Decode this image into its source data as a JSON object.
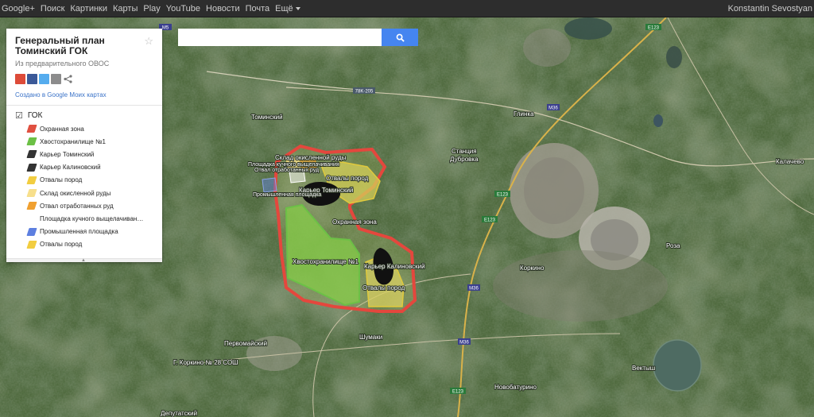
{
  "topbar": {
    "links": [
      "Google+",
      "Поиск",
      "Картинки",
      "Карты",
      "Play",
      "YouTube",
      "Новости",
      "Почта",
      "Ещё"
    ],
    "user": "Konstantin Sevostyan"
  },
  "search": {
    "placeholder": "",
    "button_icon": "search-icon"
  },
  "panel": {
    "title": "Генеральный план Томинский ГОК",
    "subtitle": "Из предварительного ОВОС",
    "created_link": "Создано в Google Моих картах",
    "layer_name": "ГОК",
    "layer_checked": true,
    "items": [
      {
        "label": "Охранная зона",
        "color": "#e05040"
      },
      {
        "label": "Хвостохранилище №1",
        "color": "#6cc046"
      },
      {
        "label": "Карьер Томинский",
        "color": "#333333"
      },
      {
        "label": "Карьер Калиновский",
        "color": "#333333"
      },
      {
        "label": "Отвалы пород",
        "color": "#f2cd40"
      },
      {
        "label": "Склад окисленной руды",
        "color": "#f7df8c"
      },
      {
        "label": "Отвал отработанных руд",
        "color": "#f0a030"
      },
      {
        "label": "Площадка кучного выщелачиван…",
        "color": ""
      },
      {
        "label": "Промышленная площадка",
        "color": "#5d7fe0"
      },
      {
        "label": "Отвалы пород",
        "color": "#f2cd40"
      }
    ]
  },
  "map": {
    "place_labels": {
      "tominsky": "Томинский",
      "glinka": "Глинка",
      "station": "Станция",
      "station2": "Дубровка",
      "kalachevo": "Калачево",
      "roza": "Роза",
      "korkino": "Коркино",
      "pervomaisky": "Первомайский",
      "shumaki": "Шумаки",
      "school": "Г. Коркино № 28 СОШ",
      "vektysh": "Вектыш",
      "novobaturino": "Новобатурино",
      "deputatsky": "Депутатский"
    },
    "road_labels": {
      "m5": "M5",
      "e123a": "E123",
      "r78": "78K-205",
      "m36a": "M36",
      "e123b": "E123",
      "e123c": "E123",
      "m36b": "M36",
      "m36c": "M36",
      "e123d": "E123"
    },
    "feature_labels": {
      "f1": "Склад окисленной руды",
      "f2": "Площадка кучного выщелачивания",
      "f3": "Отвал отработанных руд",
      "f4": "Отвалы пород",
      "f5": "Карьер Томинский",
      "f6": "Промышленная площадка",
      "f7": "Охранная зона",
      "f8": "Хвостохранилище №1",
      "f9": "Карьер Калиновский",
      "f10": "Отвалы пород"
    }
  }
}
